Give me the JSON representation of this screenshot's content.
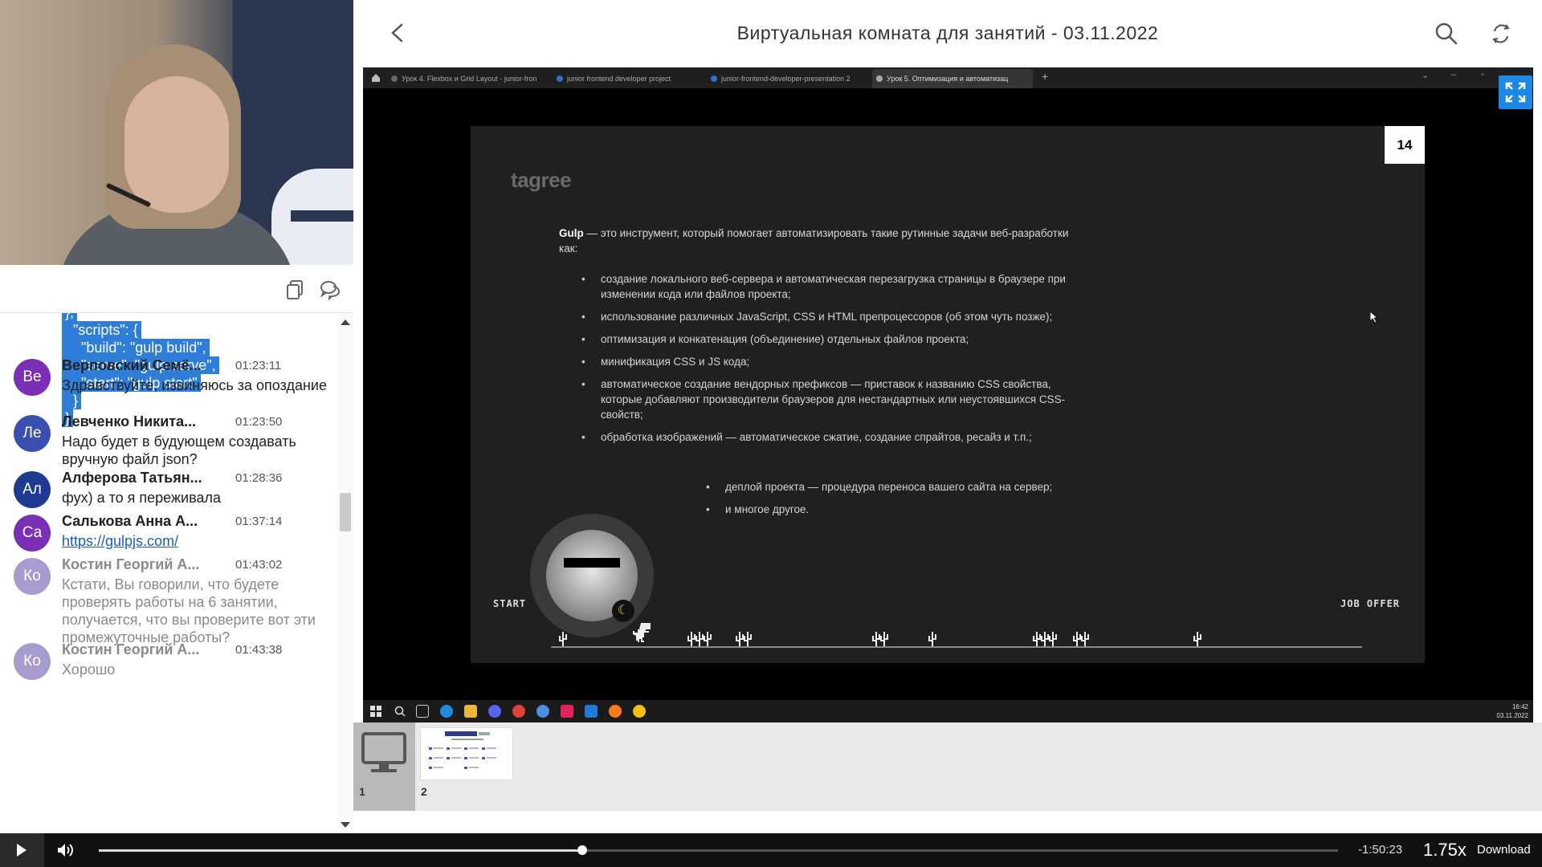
{
  "header": {
    "title": "Виртуальная комната для занятий - 03.11.2022"
  },
  "chat": {
    "code_lines": [
      "},",
      "  \"scripts\": {",
      "    \"build\": \"gulp build\",",
      "    \"serve\": \"gulp serve\",",
      "    \"start\": \"gulp start\"",
      "  }",
      "}"
    ],
    "messages": [
      {
        "initials": "Ве",
        "avatar_color": "#7b2fb5",
        "author": "Верповский Семё...",
        "time": "01:23:11",
        "text": "Здравствуйте, извиняюсь за опоздание"
      },
      {
        "initials": "Ле",
        "avatar_color": "#3a4fb0",
        "author": "Левченко Никита...",
        "time": "01:23:50",
        "text": "Надо будет в будующем создавать вручную файл json?"
      },
      {
        "initials": "Ал",
        "avatar_color": "#1f3a93",
        "author": "Алферова Татьян...",
        "time": "01:28:36",
        "text": "фух) а то я переживала"
      },
      {
        "initials": "Са",
        "avatar_color": "#7b2fb5",
        "author": "Салькова Анна А...",
        "time": "01:37:14",
        "text": "https://gulpjs.com/"
      },
      {
        "initials": "Ко",
        "avatar_color": "#a79ccd",
        "author": "Костин Георгий А...",
        "time": "01:43:02",
        "text": "Кстати, Вы говорили, что будете проверять работы на 6 занятии, получается, что вы проверите вот эти промежуточные работы?"
      },
      {
        "initials": "Ко",
        "avatar_color": "#a79ccd",
        "author": "Костин Георгий А...",
        "time": "01:43:38",
        "text": "Хорошо"
      }
    ]
  },
  "screen": {
    "browser_tabs": [
      "Урок 4. Flexbox и Grid Layout - junior-fron",
      "junior frontend developer project",
      "junior-frontend-developer-presentation 2",
      "Урок 5. Оптимизация и автоматизац"
    ],
    "slide": {
      "page_number": "14",
      "logo": "tagree",
      "intro_bold": "Gulp",
      "intro_rest": " — это инструмент, который помогает автоматизировать такие рутинные задачи веб-разработки как:",
      "bullets": [
        "создание локального веб-сервера и автоматическая перезагрузка страницы в браузере при изменении кода или файлов проекта;",
        "использование различных JavaScript, CSS и HTML препроцессоров (об этом чуть позже);",
        "оптимизация и конкатенация (объединение) отдельных файлов проекта;",
        "минификация CSS и JS кода;",
        "автоматическое создание вендорных префиксов — приставок к названию CSS свойства, которые добавляют производители браузеров для нестандартных или неустоявшихся CSS-свойств;",
        "обработка изображений — автоматическое сжатие, создание спрайтов, ресайз и т.п.;"
      ],
      "bullets_2": [
        "деплой проекта — процедура переноса вашего сайта на сервер;",
        "и многое другое."
      ],
      "start_label": "START",
      "job_label": "JOB OFFER"
    },
    "taskbar": {
      "time": "16:42",
      "date": "03.11.2022"
    }
  },
  "thumbnails": [
    {
      "label": "1"
    },
    {
      "label": "2"
    }
  ],
  "player": {
    "remaining": "-1:50:23",
    "speed": "1.75x",
    "download_label": "Download",
    "progress": 0.39
  }
}
